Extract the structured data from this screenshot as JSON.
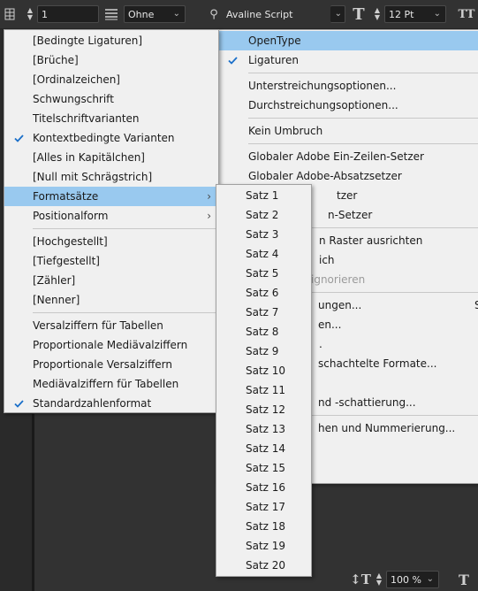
{
  "control_bar": {
    "paragraph_field": "1",
    "style_select": "Ohne",
    "font_family": "Avaline Script",
    "font_size": "12 Pt"
  },
  "menu_left": {
    "items": [
      {
        "label": "[Bedingte Ligaturen]",
        "checked": false
      },
      {
        "label": "[Brüche]",
        "checked": false
      },
      {
        "label": "[Ordinalzeichen]",
        "checked": false
      },
      {
        "label": "Schwungschrift",
        "checked": false
      },
      {
        "label": "Titelschriftvarianten",
        "checked": false
      },
      {
        "label": "Kontextbedingte Varianten",
        "checked": true
      },
      {
        "label": "[Alles in Kapitälchen]",
        "checked": false
      },
      {
        "label": "[Null mit Schrägstrich]",
        "checked": false
      },
      {
        "label": "Formatsätze",
        "checked": false,
        "submenu": true,
        "highlighted": true
      },
      {
        "label": "Positionalform",
        "checked": false,
        "submenu": true
      },
      {
        "label": "[Hochgestellt]",
        "checked": false
      },
      {
        "label": "[Tiefgestellt]",
        "checked": false
      },
      {
        "label": "[Zähler]",
        "checked": false
      },
      {
        "label": "[Nenner]",
        "checked": false
      },
      {
        "label": "Versalziffern für Tabellen",
        "checked": false
      },
      {
        "label": "Proportionale Mediävalziffern",
        "checked": false
      },
      {
        "label": "Proportionale Versalziffern",
        "checked": false
      },
      {
        "label": "Mediävalziffern für Tabellen",
        "checked": false
      },
      {
        "label": "Standardzahlenformat",
        "checked": true
      }
    ]
  },
  "menu_right": {
    "items": [
      {
        "label": "OpenType",
        "highlighted": true
      },
      {
        "label": "Ligaturen",
        "checked": true
      },
      {
        "label": "Unterstreichungsoptionen..."
      },
      {
        "label": "Durchstreichungsoptionen..."
      },
      {
        "label": "Kein Umbruch"
      },
      {
        "label": "Globaler Adobe Ein-Zeilen-Setzer"
      },
      {
        "label": "Globaler Adobe-Absatzsetzer"
      },
      {
        "label": "tzer"
      },
      {
        "label": "n-Setzer"
      },
      {
        "label": "n Raster ausrichten"
      },
      {
        "label": "ich"
      },
      {
        "label": "ignorieren",
        "disabled": true
      },
      {
        "label": "ungen..."
      },
      {
        "label": "en..."
      },
      {
        "label": "."
      },
      {
        "label": "schachtelte Formate..."
      },
      {
        "label": ""
      },
      {
        "label": "nd -schattierung..."
      },
      {
        "label": "hen und Nummerierung..."
      }
    ],
    "cutoff_letter": "S"
  },
  "menu_satz": {
    "items": [
      "Satz 1",
      "Satz 2",
      "Satz 3",
      "Satz 4",
      "Satz 5",
      "Satz 6",
      "Satz 7",
      "Satz 8",
      "Satz 9",
      "Satz 10",
      "Satz 11",
      "Satz 12",
      "Satz 13",
      "Satz 14",
      "Satz 15",
      "Satz 16",
      "Satz 17",
      "Satz 18",
      "Satz 19",
      "Satz 20"
    ]
  },
  "bottom_bar": {
    "zoom": "100 %"
  },
  "icons": {
    "check": "checkmark-icon",
    "submenu": "chevron-right-icon"
  },
  "colors": {
    "menu_bg": "#f0f0f0",
    "highlight": "#99c9ef",
    "app_bg": "#323232"
  }
}
